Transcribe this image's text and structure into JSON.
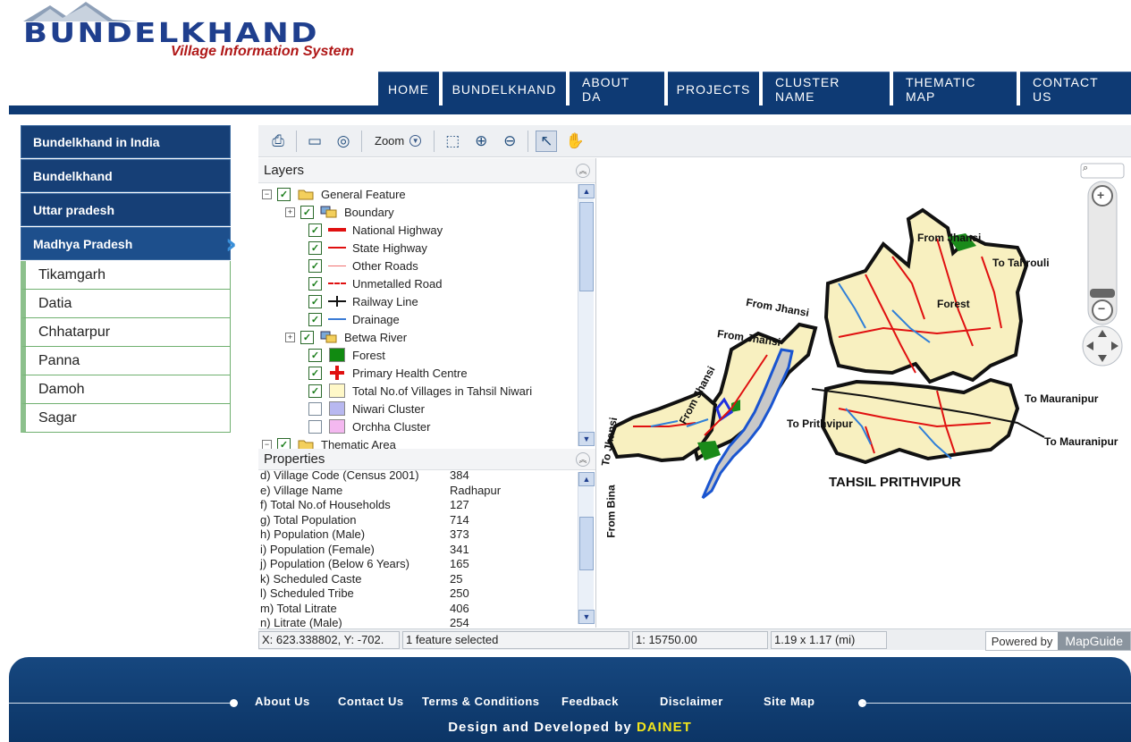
{
  "header": {
    "brand": "BUNDELKHAND",
    "tagline": "Village Information System",
    "nav": [
      "HOME",
      "BUNDELKHAND",
      "ABOUT DA",
      "PROJECTS",
      "CLUSTER NAME",
      "THEMATIC MAP",
      "CONTACT US"
    ]
  },
  "sidebar": {
    "main": [
      "Bundelkhand in India",
      "Bundelkhand",
      "Uttar pradesh",
      "Madhya Pradesh"
    ],
    "active": "Madhya Pradesh",
    "sub": [
      "Tikamgarh",
      "Datia",
      "Chhatarpur",
      "Panna",
      "Damoh",
      "Sagar"
    ]
  },
  "toolbar": {
    "zoom_label": "Zoom",
    "icons": [
      "print-icon",
      "measure-icon",
      "buffer-icon",
      "zoom-dropdown",
      "zoom-rectangle-icon",
      "zoom-in-icon",
      "zoom-out-icon",
      "select-pointer-icon",
      "pan-icon"
    ]
  },
  "layers": {
    "title": "Layers",
    "items": [
      {
        "label": "General Feature",
        "checked": true,
        "symbol": "folder-icon",
        "expander": "minus"
      },
      {
        "label": "Boundary",
        "checked": true,
        "symbol": "layer-group-icon",
        "expander": "plus"
      },
      {
        "label": "National Highway",
        "checked": true,
        "symbol": "thick-red-line",
        "color": "#e01010"
      },
      {
        "label": "State Highway",
        "checked": true,
        "symbol": "red-line",
        "color": "#e01010"
      },
      {
        "label": "Other Roads",
        "checked": true,
        "symbol": "thin-red-line",
        "color": "#f07070"
      },
      {
        "label": "Unmetalled Road",
        "checked": true,
        "symbol": "dashed-red-line",
        "color": "#e01010"
      },
      {
        "label": "Railway Line",
        "checked": true,
        "symbol": "railway-line",
        "color": "#111111"
      },
      {
        "label": "Drainage",
        "checked": true,
        "symbol": "blue-line",
        "color": "#3a7bd5"
      },
      {
        "label": "Betwa River",
        "checked": true,
        "symbol": "layer-group-icon",
        "expander": "plus"
      },
      {
        "label": "Forest",
        "checked": true,
        "symbol": "green-square",
        "color": "#118a11"
      },
      {
        "label": "Primary Health Centre",
        "checked": true,
        "symbol": "red-cross",
        "color": "#e01010"
      },
      {
        "label": "Total No.of Villages in Tahsil Niwari",
        "checked": true,
        "symbol": "cream-square",
        "color": "#fff8c8"
      },
      {
        "label": "Niwari Cluster",
        "checked": false,
        "symbol": "lavender-square",
        "color": "#b8b8f0"
      },
      {
        "label": "Orchha Cluster",
        "checked": false,
        "symbol": "pink-square",
        "color": "#f4b8f0"
      },
      {
        "label": "Thematic Area",
        "checked": true,
        "symbol": "folder-icon",
        "expander": "minus"
      }
    ]
  },
  "properties": {
    "title": "Properties",
    "rows": [
      {
        "k": "d) Village Code (Census 2001)",
        "v": "384"
      },
      {
        "k": "e) Village Name",
        "v": "Radhapur"
      },
      {
        "k": "f) Total No.of Households",
        "v": "127"
      },
      {
        "k": "g) Total Population",
        "v": "714"
      },
      {
        "k": "h) Population (Male)",
        "v": "373"
      },
      {
        "k": "i) Population (Female)",
        "v": "341"
      },
      {
        "k": "j) Population (Below 6 Years)",
        "v": "165"
      },
      {
        "k": "k) Scheduled Caste",
        "v": "25"
      },
      {
        "k": "l) Scheduled Tribe",
        "v": "250"
      },
      {
        "k": "m) Total Litrate",
        "v": "406"
      },
      {
        "k": "n) Litrate (Male)",
        "v": "254"
      }
    ]
  },
  "statusbar": {
    "coords": "X: 623.338802, Y: -702.",
    "selection": "1 feature selected",
    "scale": "1: 15750.00",
    "size": "1.19 x 1.17 (mi)",
    "powered_by": "Powered by",
    "engine": "MapGuide"
  },
  "map": {
    "labels": {
      "from_jhansi_1": "From Jhansi",
      "to_tahrouli": "To Tahrouli",
      "forest": "Forest",
      "from_jhansi_2": "From Jhansi",
      "from_jhansi_3": "From Jhansi",
      "to_mauranipur_1": "To Mauranipur",
      "to_prithvipur": "To Prithvipur",
      "to_mauranipur_2": "To Mauranipur",
      "from_jhansi_4": "From Jhansi",
      "to_jhansi": "To Jhansi",
      "from_bina": "From Bina",
      "tahsil": "TAHSIL PRITHVIPUR"
    },
    "colors": {
      "land": "#f8f0c0",
      "boundary": "#111111",
      "road": "#e01010",
      "drainage": "#2f7fd8",
      "river": "#2060d0"
    }
  },
  "footer": {
    "links": [
      "About Us",
      "Contact Us",
      "Terms & Conditions",
      "Feedback",
      "Disclaimer",
      "Site Map"
    ],
    "credit_prefix": "Design and Developed by",
    "credit_company": "DAINET"
  }
}
